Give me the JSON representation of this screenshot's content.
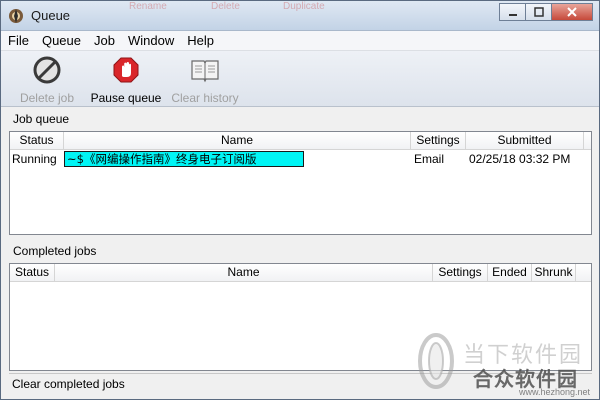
{
  "window": {
    "title": "Queue",
    "background_ghost_labels": [
      "Rename",
      "Delete",
      "Duplicate"
    ]
  },
  "menu": [
    "File",
    "Queue",
    "Job",
    "Window",
    "Help"
  ],
  "toolbar": {
    "buttons": [
      {
        "label": "Delete job",
        "icon": "no-entry-icon",
        "enabled": false
      },
      {
        "label": "Pause queue",
        "icon": "stop-hand-icon",
        "enabled": true
      },
      {
        "label": "Clear history",
        "icon": "book-icon",
        "enabled": false
      }
    ]
  },
  "job_queue": {
    "label": "Job queue",
    "columns": [
      "Status",
      "Name",
      "Settings",
      "Submitted"
    ],
    "rows": [
      {
        "status": "Running",
        "name": "~$《网编操作指南》终身电子订阅版",
        "settings": "Email",
        "submitted": "02/25/18 03:32 PM"
      }
    ]
  },
  "completed_jobs": {
    "label": "Completed jobs",
    "columns": [
      "Status",
      "Name",
      "Settings",
      "Ended",
      "Shrunk"
    ],
    "rows": []
  },
  "status_bar": {
    "text": "Clear completed jobs"
  },
  "watermark": {
    "line1": "当下软件园",
    "line2": "合众软件园",
    "url": "www.hezhong.net"
  },
  "colors": {
    "selection_highlight": "#00f5f5",
    "pause_icon_red": "#d9262a",
    "close_button": "#c6493a"
  }
}
